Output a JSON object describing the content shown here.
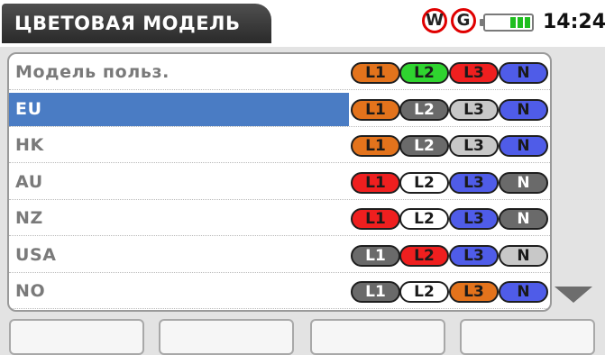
{
  "header": {
    "title": "ЦВЕТОВАЯ МОДЕЛЬ",
    "status_w": "W",
    "status_g": "G",
    "time": "14:24",
    "battery_icon": "battery-icon"
  },
  "models": [
    {
      "label": "Модель польз.",
      "selected": false,
      "phases": [
        {
          "text": "L1",
          "bg": "#e3731c",
          "fg": "#1a1a1a"
        },
        {
          "text": "L2",
          "bg": "#2fd42f",
          "fg": "#1a1a1a"
        },
        {
          "text": "L3",
          "bg": "#ef1f1f",
          "fg": "#1a1a1a"
        },
        {
          "text": "N",
          "bg": "#4f5ce8",
          "fg": "#1a1a1a"
        }
      ]
    },
    {
      "label": "EU",
      "selected": true,
      "phases": [
        {
          "text": "L1",
          "bg": "#e3731c",
          "fg": "#1a1a1a"
        },
        {
          "text": "L2",
          "bg": "#6a6a6a",
          "fg": "#ffffff"
        },
        {
          "text": "L3",
          "bg": "#c8c8c8",
          "fg": "#1a1a1a"
        },
        {
          "text": "N",
          "bg": "#4f5ce8",
          "fg": "#1a1a1a"
        }
      ]
    },
    {
      "label": "HK",
      "selected": false,
      "phases": [
        {
          "text": "L1",
          "bg": "#e3731c",
          "fg": "#1a1a1a"
        },
        {
          "text": "L2",
          "bg": "#6a6a6a",
          "fg": "#ffffff"
        },
        {
          "text": "L3",
          "bg": "#c8c8c8",
          "fg": "#1a1a1a"
        },
        {
          "text": "N",
          "bg": "#4f5ce8",
          "fg": "#1a1a1a"
        }
      ]
    },
    {
      "label": "AU",
      "selected": false,
      "phases": [
        {
          "text": "L1",
          "bg": "#ef1f1f",
          "fg": "#1a1a1a"
        },
        {
          "text": "L2",
          "bg": "#ffffff",
          "fg": "#1a1a1a"
        },
        {
          "text": "L3",
          "bg": "#4f5ce8",
          "fg": "#1a1a1a"
        },
        {
          "text": "N",
          "bg": "#6a6a6a",
          "fg": "#ffffff"
        }
      ]
    },
    {
      "label": "NZ",
      "selected": false,
      "phases": [
        {
          "text": "L1",
          "bg": "#ef1f1f",
          "fg": "#1a1a1a"
        },
        {
          "text": "L2",
          "bg": "#ffffff",
          "fg": "#1a1a1a"
        },
        {
          "text": "L3",
          "bg": "#4f5ce8",
          "fg": "#1a1a1a"
        },
        {
          "text": "N",
          "bg": "#6a6a6a",
          "fg": "#ffffff"
        }
      ]
    },
    {
      "label": "USA",
      "selected": false,
      "phases": [
        {
          "text": "L1",
          "bg": "#6a6a6a",
          "fg": "#ffffff"
        },
        {
          "text": "L2",
          "bg": "#ef1f1f",
          "fg": "#1a1a1a"
        },
        {
          "text": "L3",
          "bg": "#4f5ce8",
          "fg": "#1a1a1a"
        },
        {
          "text": "N",
          "bg": "#c8c8c8",
          "fg": "#1a1a1a"
        }
      ]
    },
    {
      "label": "NO",
      "selected": false,
      "phases": [
        {
          "text": "L1",
          "bg": "#6a6a6a",
          "fg": "#ffffff"
        },
        {
          "text": "L2",
          "bg": "#ffffff",
          "fg": "#1a1a1a"
        },
        {
          "text": "L3",
          "bg": "#e3731c",
          "fg": "#1a1a1a"
        },
        {
          "text": "N",
          "bg": "#4f5ce8",
          "fg": "#1a1a1a"
        }
      ]
    }
  ],
  "colors": {
    "selection": "#4a7cc4",
    "header_bg": "#333333",
    "status_ring": "#e00000",
    "battery_fill": "#1fbe1f"
  },
  "scroll_icon": "scroll-down-arrow-icon"
}
